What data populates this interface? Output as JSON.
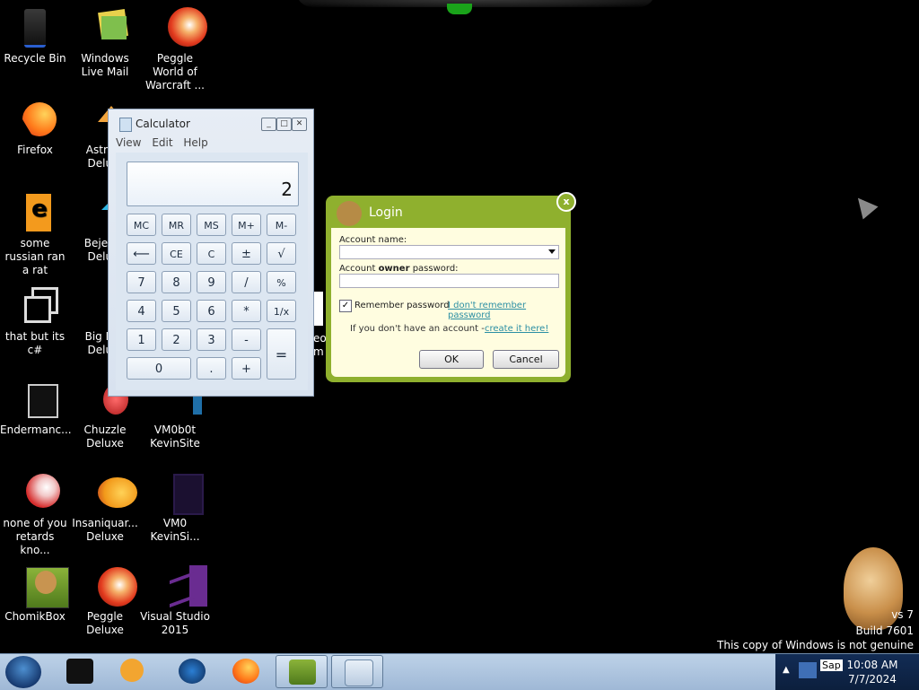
{
  "desktop": {
    "icons": [
      {
        "label": "Recycle Bin"
      },
      {
        "label": "Windows Live Mail"
      },
      {
        "label": "Peggle World of Warcraft ..."
      },
      {
        "label": "Firefox"
      },
      {
        "label": "Astro... Delu..."
      },
      {
        "label": "some russian ran a rat"
      },
      {
        "label": "Bejew... Delu..."
      },
      {
        "label": "that but its c#"
      },
      {
        "label": "Big M... Delu..."
      },
      {
        "label": "Endermanc..."
      },
      {
        "label": "Chuzzle Deluxe"
      },
      {
        "label": "VM0b0t KevinSite"
      },
      {
        "label": "none of you retards kno..."
      },
      {
        "label": "Insaniquar... Deluxe"
      },
      {
        "label": "VM0 KevinSi..."
      },
      {
        "label": "ChomikBox"
      },
      {
        "label": "Peggle Deluxe"
      },
      {
        "label": "Visual Studio 2015"
      }
    ]
  },
  "calculator": {
    "title": "Calculator",
    "menu": [
      "View",
      "Edit",
      "Help"
    ],
    "display": "2",
    "keys": [
      "MC",
      "MR",
      "MS",
      "M+",
      "M-",
      "⟵",
      "CE",
      "C",
      "±",
      "√",
      "7",
      "8",
      "9",
      "/",
      "%",
      "4",
      "5",
      "6",
      "*",
      "1/x",
      "1",
      "2",
      "3",
      "-",
      "=",
      "0",
      ".",
      "+"
    ]
  },
  "login": {
    "title": "Login",
    "close": "x",
    "account_name_label": "Account name:",
    "password_label_pre": "Account ",
    "password_label_bold": "owner",
    "password_label_post": " password:",
    "remember_label": "Remember password",
    "forgot_link": "I don't remember password",
    "no_account_text": "If you don't have an account - ",
    "create_link": "create it here!",
    "ok": "OK",
    "cancel": "Cancel"
  },
  "watermark": {
    "line1": "vs 7",
    "line2": "Build 7601",
    "line3": "This copy of Windows is not genuine"
  },
  "taskbar": {
    "tray_lang": "Sap",
    "time": "10:08 AM",
    "date": "7/7/2024"
  }
}
